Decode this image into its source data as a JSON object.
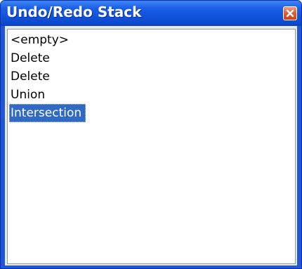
{
  "window": {
    "title": "Undo/Redo Stack",
    "close_icon": "close-icon",
    "colors": {
      "titlebar": "#0f4fd8",
      "frame": "#1f57d8",
      "close_button": "#e0603c",
      "selection": "#316ac5"
    }
  },
  "list": {
    "items": [
      {
        "label": "<empty>",
        "selected": false
      },
      {
        "label": "Delete",
        "selected": false
      },
      {
        "label": "Delete",
        "selected": false
      },
      {
        "label": "Union",
        "selected": false
      },
      {
        "label": "Intersection",
        "selected": true
      }
    ]
  }
}
